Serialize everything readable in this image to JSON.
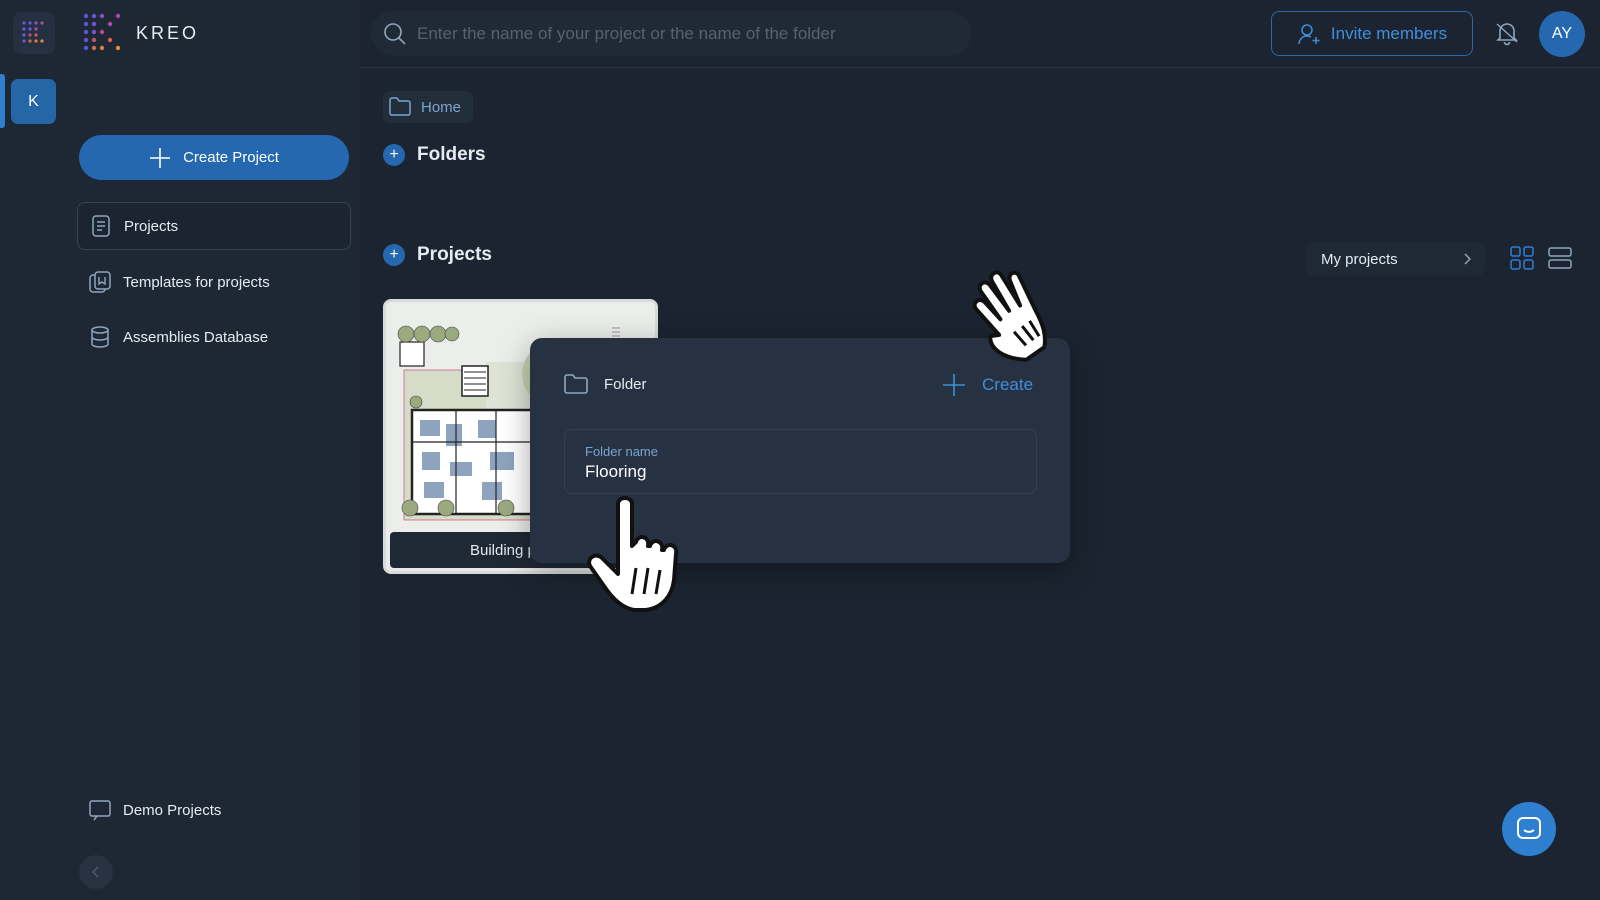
{
  "app": {
    "brand_name": "KREO",
    "company_initial": "K",
    "accent_color": "#2568b0"
  },
  "sidebar": {
    "create_project_label": "Create Project",
    "items": [
      {
        "label": "Projects",
        "icon": "document-icon",
        "active": true
      },
      {
        "label": "Templates for projects",
        "icon": "templates-icon",
        "active": false
      },
      {
        "label": "Assemblies Database",
        "icon": "database-icon",
        "active": false
      }
    ],
    "demo_projects_label": "Demo Projects"
  },
  "topbar": {
    "search_placeholder": "Enter the name of your project or the name of the folder",
    "invite_label": "Invite members",
    "avatar_initials": "AY"
  },
  "main": {
    "breadcrumb": "Home",
    "folders_heading": "Folders",
    "projects_heading": "Projects",
    "filter_label": "My projects",
    "project_card_label": "Building p"
  },
  "folder_popup": {
    "title": "Folder",
    "create_label": "Create",
    "field_label": "Folder name",
    "field_value": "Flooring"
  }
}
